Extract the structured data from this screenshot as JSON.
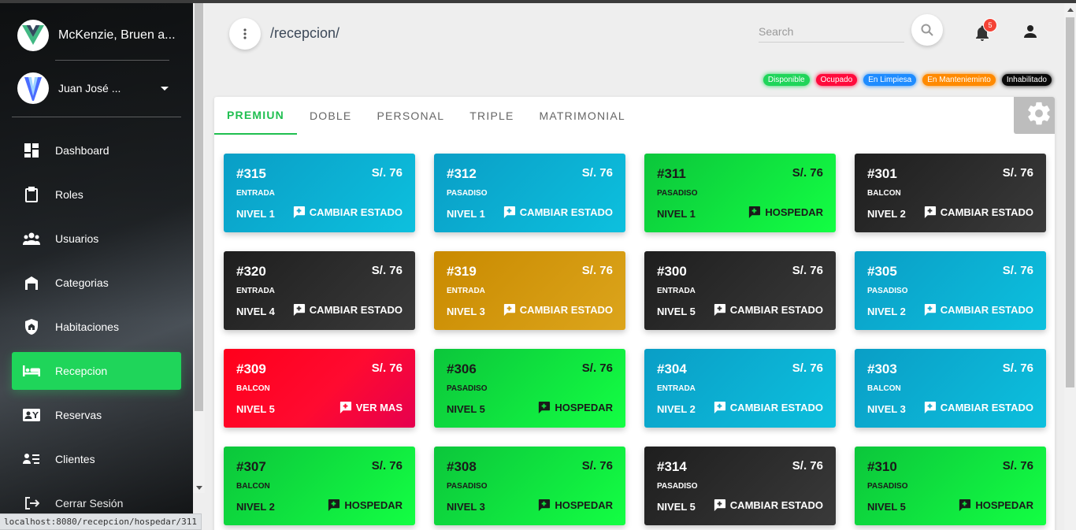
{
  "sidebar": {
    "brand": "McKenzie, Bruen a...",
    "user_name": "Juan José ...",
    "nav": [
      {
        "label": "Dashboard",
        "icon": "dashboard-icon"
      },
      {
        "label": "Roles",
        "icon": "clipboard-icon"
      },
      {
        "label": "Usuarios",
        "icon": "people-icon"
      },
      {
        "label": "Categorias",
        "icon": "building-icon"
      },
      {
        "label": "Habitaciones",
        "icon": "shield-home-icon"
      },
      {
        "label": "Recepcion",
        "icon": "bed-icon",
        "active": true
      },
      {
        "label": "Reservas",
        "icon": "contact-card-icon"
      },
      {
        "label": "Clientes",
        "icon": "person-list-icon"
      },
      {
        "label": "Cerrar Sesión",
        "icon": "logout-icon"
      }
    ]
  },
  "header": {
    "route": "/recepcion/",
    "search_placeholder": "Search",
    "notification_count": "5"
  },
  "legend": [
    {
      "label": "Disponible",
      "color": "#1fd55a"
    },
    {
      "label": "Ocupado",
      "color": "#ff0a3c"
    },
    {
      "label": "En Limpiesa",
      "color": "#1e8cff"
    },
    {
      "label": "En Mantenieminto",
      "color": "#ff8a00"
    },
    {
      "label": "Inhabilitado",
      "color": "#0a0a0a"
    }
  ],
  "tabs": [
    "PREMIUN",
    "DOBLE",
    "PERSONAL",
    "TRIPLE",
    "MATRIMONIAL"
  ],
  "rooms": [
    {
      "num": "#315",
      "price": "S/. 76",
      "loc": "ENTRADA",
      "nivel": "NIVEL 1",
      "action": "CAMBIAR ESTADO",
      "style": "cyan"
    },
    {
      "num": "#312",
      "price": "S/. 76",
      "loc": "PASADISO",
      "nivel": "NIVEL 1",
      "action": "CAMBIAR ESTADO",
      "style": "cyan"
    },
    {
      "num": "#311",
      "price": "S/. 76",
      "loc": "PASADISO",
      "nivel": "NIVEL 1",
      "action": "HOSPEDAR",
      "style": "green"
    },
    {
      "num": "#301",
      "price": "S/. 76",
      "loc": "BALCON",
      "nivel": "NIVEL 2",
      "action": "CAMBIAR ESTADO",
      "style": "dark"
    },
    {
      "num": "#320",
      "price": "S/. 76",
      "loc": "ENTRADA",
      "nivel": "NIVEL 4",
      "action": "CAMBIAR ESTADO",
      "style": "dark"
    },
    {
      "num": "#319",
      "price": "S/. 76",
      "loc": "ENTRADA",
      "nivel": "NIVEL 3",
      "action": "CAMBIAR ESTADO",
      "style": "orange"
    },
    {
      "num": "#300",
      "price": "S/. 76",
      "loc": "ENTRADA",
      "nivel": "NIVEL 5",
      "action": "CAMBIAR ESTADO",
      "style": "dark"
    },
    {
      "num": "#305",
      "price": "S/. 76",
      "loc": "PASADISO",
      "nivel": "NIVEL 2",
      "action": "CAMBIAR ESTADO",
      "style": "cyan"
    },
    {
      "num": "#309",
      "price": "S/. 76",
      "loc": "BALCON",
      "nivel": "NIVEL 5",
      "action": "VER MAS",
      "style": "red"
    },
    {
      "num": "#306",
      "price": "S/. 76",
      "loc": "PASADISO",
      "nivel": "NIVEL 5",
      "action": "HOSPEDAR",
      "style": "green"
    },
    {
      "num": "#304",
      "price": "S/. 76",
      "loc": "ENTRADA",
      "nivel": "NIVEL 2",
      "action": "CAMBIAR ESTADO",
      "style": "cyan"
    },
    {
      "num": "#303",
      "price": "S/. 76",
      "loc": "BALCON",
      "nivel": "NIVEL 3",
      "action": "CAMBIAR ESTADO",
      "style": "cyan"
    },
    {
      "num": "#307",
      "price": "S/. 76",
      "loc": "BALCON",
      "nivel": "NIVEL 2",
      "action": "HOSPEDAR",
      "style": "green"
    },
    {
      "num": "#308",
      "price": "S/. 76",
      "loc": "PASADISO",
      "nivel": "NIVEL 3",
      "action": "HOSPEDAR",
      "style": "green"
    },
    {
      "num": "#314",
      "price": "S/. 76",
      "loc": "PASADISO",
      "nivel": "NIVEL 5",
      "action": "CAMBIAR ESTADO",
      "style": "dark"
    },
    {
      "num": "#310",
      "price": "S/. 76",
      "loc": "PASADISO",
      "nivel": "NIVEL 5",
      "action": "HOSPEDAR",
      "style": "green"
    }
  ],
  "status_url": "localhost:8080/recepcion/hospedar/311"
}
